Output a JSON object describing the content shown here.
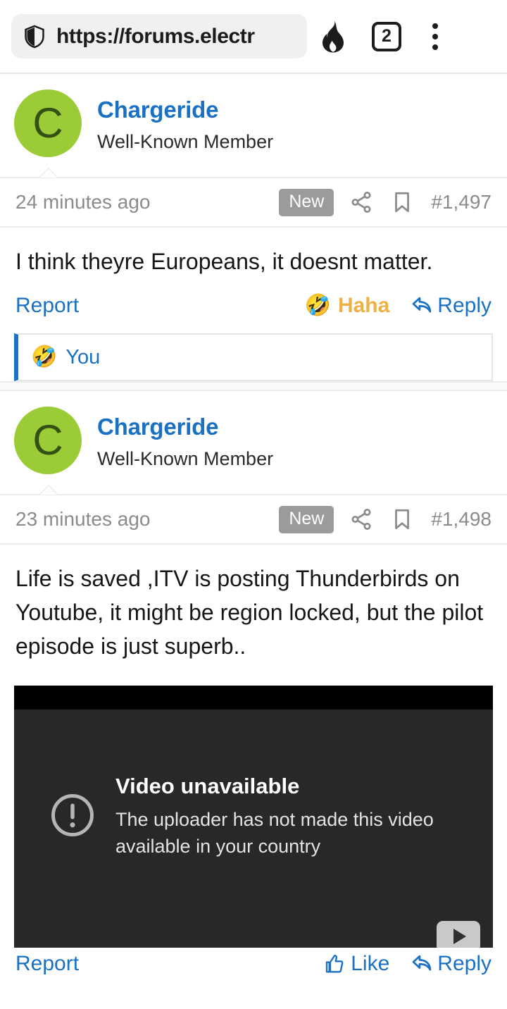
{
  "browser": {
    "url": "https://forums.electr",
    "shield_icon": "shield-icon",
    "shields_icon": "flame-icon",
    "tab_count": "2",
    "menu_icon": "three-dot-menu-icon"
  },
  "posts": [
    {
      "avatar_letter": "C",
      "username": "Chargeride",
      "user_title": "Well-Known Member",
      "timestamp": "24 minutes ago",
      "new_badge": "New",
      "share_icon": "share-icon",
      "bookmark_icon": "bookmark-icon",
      "post_number": "#1,497",
      "body": "I think theyre Europeans, it doesnt matter.",
      "report_label": "Report",
      "reaction_label": "Haha",
      "reaction_emoji": "🤣",
      "reply_label": "Reply",
      "reactions": {
        "emoji": "🤣",
        "who": "You"
      }
    },
    {
      "avatar_letter": "C",
      "username": "Chargeride",
      "user_title": "Well-Known Member",
      "timestamp": "23 minutes ago",
      "new_badge": "New",
      "share_icon": "share-icon",
      "bookmark_icon": "bookmark-icon",
      "post_number": "#1,498",
      "body": "Life is saved ,ITV is posting Thunderbirds on Youtube, it might be region locked, but the pilot episode is just superb..",
      "report_label": "Report",
      "like_label": "Like",
      "reply_label": "Reply",
      "video": {
        "title": "Video unavailable",
        "subtitle": "The uploader has not made this video available in your country",
        "warn_icon": "circle-exclamation-icon",
        "play_icon": "youtube-play-icon"
      }
    }
  ],
  "colors": {
    "link": "#1a71c4",
    "avatar_bg": "#9ccb38",
    "reaction_gold": "#eeb145",
    "badge_gray": "#9b9b9b",
    "video_bg": "#282828"
  }
}
